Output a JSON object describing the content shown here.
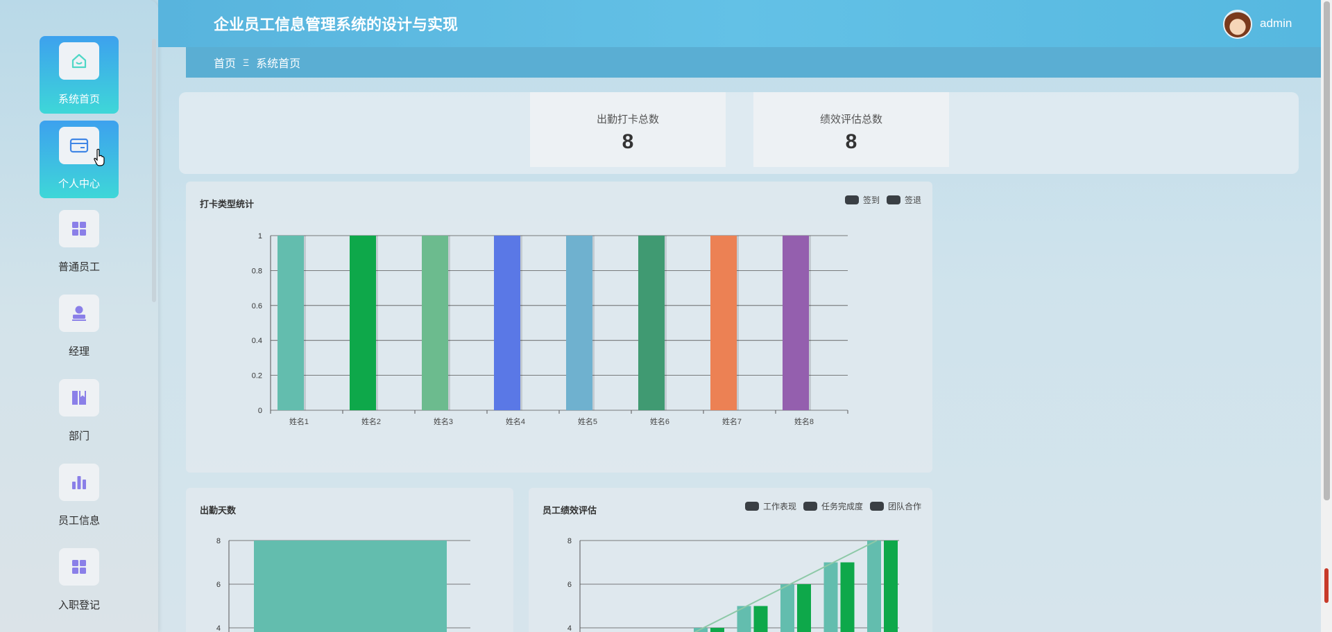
{
  "header": {
    "title": "企业员工信息管理系统的设计与实现",
    "username": "admin"
  },
  "breadcrumb": {
    "home": "首页",
    "separator": "Ξ",
    "current": "系统首页"
  },
  "sidebar": {
    "items": [
      {
        "label": "系统首页",
        "icon": "home-icon",
        "active": true
      },
      {
        "label": "个人中心",
        "icon": "card-icon",
        "active": true
      },
      {
        "label": "普通员工",
        "icon": "grid-icon",
        "active": false
      },
      {
        "label": "经理",
        "icon": "person-stamp-icon",
        "active": false
      },
      {
        "label": "部门",
        "icon": "book-icon",
        "active": false
      },
      {
        "label": "员工信息",
        "icon": "bar-chart-icon",
        "active": false
      },
      {
        "label": "入职登记",
        "icon": "grid-icon",
        "active": false
      }
    ]
  },
  "stats": [
    {
      "title": "出勤打卡总数",
      "value": "8"
    },
    {
      "title": "绩效评估总数",
      "value": "8"
    }
  ],
  "panels": {
    "punch": {
      "title": "打卡类型统计",
      "legend": [
        "签到",
        "签退"
      ]
    },
    "attendance": {
      "title": "出勤天数"
    },
    "performance": {
      "title": "员工绩效评估",
      "legend": [
        "工作表现",
        "任务完成度",
        "团队合作"
      ]
    }
  },
  "colors": {
    "accent": "#3da1ee",
    "accent2": "#3ed7d8",
    "icon": "#8a7fe8",
    "header": "#5cbbe3"
  },
  "chart_data": [
    {
      "type": "bar",
      "title": "打卡类型统计",
      "categories": [
        "姓名1",
        "姓名2",
        "姓名3",
        "姓名4",
        "姓名5",
        "姓名6",
        "姓名7",
        "姓名8"
      ],
      "values": [
        1,
        1,
        1,
        1,
        1,
        1,
        1,
        1
      ],
      "colors": [
        "#63bdae",
        "#0ea84a",
        "#6cbb8e",
        "#5a78e6",
        "#6fb1cf",
        "#409a72",
        "#ec8154",
        "#945fae"
      ],
      "ylim": [
        0,
        1
      ],
      "yticks": [
        "0",
        "0.2",
        "0.4",
        "0.6",
        "0.8",
        "1"
      ],
      "legend": [
        "签到",
        "签退"
      ],
      "legend_position": "top-right",
      "grid": true
    },
    {
      "type": "bar",
      "title": "出勤天数",
      "categories": [
        ""
      ],
      "values": [
        8
      ],
      "colors": [
        "#63bdae"
      ],
      "ylim": [
        0,
        8
      ],
      "yticks_visible": [
        "8",
        "6",
        "4"
      ],
      "grid": true
    },
    {
      "type": "bar",
      "title": "员工绩效评估",
      "series": [
        {
          "name": "工作表现",
          "values": [
            4,
            5,
            6,
            7,
            8
          ]
        },
        {
          "name": "任务完成度",
          "values": [
            4,
            5,
            6,
            7,
            8
          ]
        }
      ],
      "line_series": {
        "name": "团队合作",
        "values": [
          4,
          5,
          6,
          7,
          8
        ]
      },
      "colors": [
        "#63bdae",
        "#0ea84a",
        "#8dc9a7"
      ],
      "ylim": [
        0,
        8
      ],
      "yticks_visible": [
        "8",
        "6",
        "4"
      ],
      "legend_position": "top-right",
      "grid": true
    }
  ]
}
